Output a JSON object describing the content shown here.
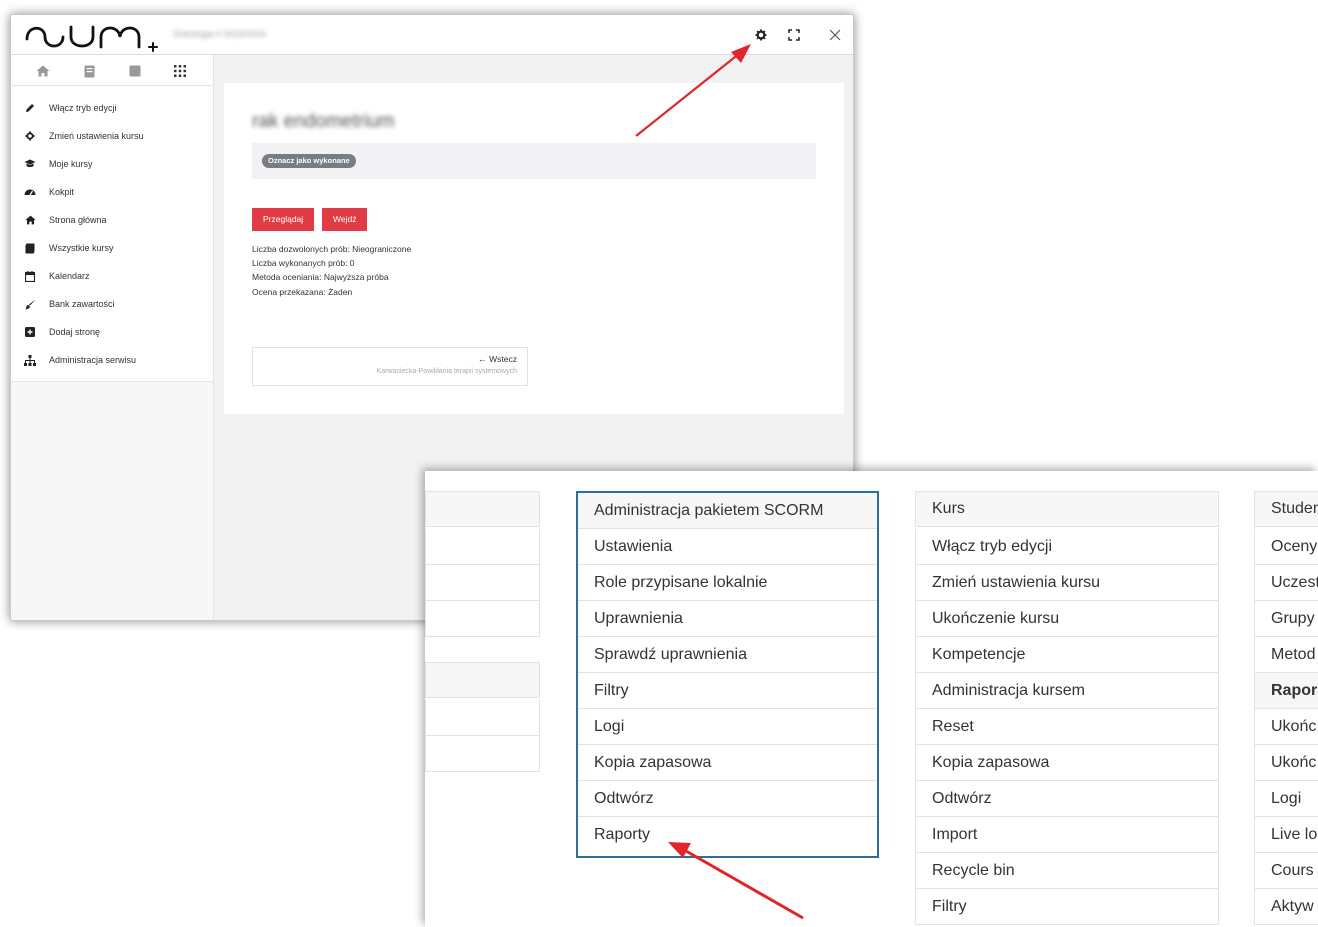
{
  "window1": {
    "logo_text": "sum+",
    "breadcrumb": "Onkologia II 2023/2024",
    "sidebar_items": [
      {
        "label": "Włącz tryb edycji",
        "icon": "pencil-icon"
      },
      {
        "label": "Zmień ustawienia kursu",
        "icon": "gear-icon"
      },
      {
        "label": "Moje kursy",
        "icon": "graduation-cap-icon"
      },
      {
        "label": "Kokpit",
        "icon": "dashboard-icon"
      },
      {
        "label": "Strona główna",
        "icon": "home-icon"
      },
      {
        "label": "Wszystkie kursy",
        "icon": "archive-icon"
      },
      {
        "label": "Kalendarz",
        "icon": "calendar-icon"
      },
      {
        "label": "Bank zawartości",
        "icon": "brush-icon"
      },
      {
        "label": "Dodaj stronę",
        "icon": "plus-square-icon"
      },
      {
        "label": "Administracja serwisu",
        "icon": "sitemap-icon"
      }
    ],
    "page_title": "rak endometrium",
    "mark_done": "Oznacz jako wykonane",
    "buttons": {
      "review": "Przeglądaj",
      "enter": "Wejdź"
    },
    "info_lines": [
      "Liczba dozwolonych prób: Nieograniczone",
      "Liczba wykonanych prób: 0",
      "Metoda oceniania: Najwyższa próba",
      "Ocena przekazana: Żaden"
    ],
    "nav_back": "← Wstecz",
    "nav_prev_link": "Karwasiecka-Powikłania terapii systemowych"
  },
  "panel": {
    "col1_rows": [
      "",
      "",
      "",
      "",
      "",
      "",
      "",
      ""
    ],
    "scorm_menu": [
      "Administracja pakietem SCORM",
      "Ustawienia",
      "Role przypisane lokalnie",
      "Uprawnienia",
      "Sprawdź uprawnienia",
      "Filtry",
      "Logi",
      "Kopia zapasowa",
      "Odtwórz",
      "Raporty"
    ],
    "course_menu": [
      "Kurs",
      "Włącz tryb edycji",
      "Zmień ustawienia kursu",
      "Ukończenie kursu",
      "Kompetencje",
      "Administracja kursem",
      "Reset",
      "Kopia zapasowa",
      "Odtwórz",
      "Import",
      "Recycle bin",
      "Filtry"
    ],
    "students_menu": [
      "Studen",
      "Oceny",
      "Uczest",
      "Grupy",
      "Metod",
      "Rapor",
      "Ukońc",
      "Ukońc",
      "Logi",
      "Live lo",
      "Cours",
      "Aktyw"
    ]
  },
  "colors": {
    "accent_red": "#e13b45",
    "highlight_blue": "#2c6f9e",
    "arrow_red": "#e0262c"
  }
}
